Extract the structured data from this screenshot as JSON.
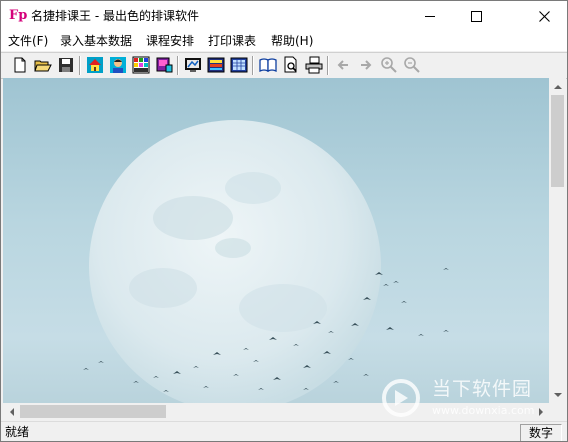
{
  "window": {
    "title": "名捷排课王 - 最出色的排课软件",
    "icon_letters": "Fp",
    "icon_name": "app-fp-icon"
  },
  "menu": [
    {
      "label": "文件(F)"
    },
    {
      "label": "录入基本数据"
    },
    {
      "label": "课程安排"
    },
    {
      "label": "打印课表"
    },
    {
      "label": "帮助(H)"
    }
  ],
  "toolbar": [
    {
      "icon": "new-file-icon"
    },
    {
      "icon": "open-folder-icon"
    },
    {
      "icon": "save-icon"
    },
    {
      "icon": "home-icon"
    },
    {
      "icon": "teacher-icon"
    },
    {
      "icon": "class-grid-icon"
    },
    {
      "icon": "course-book-icon"
    },
    {
      "icon": "monitor-schedule-icon"
    },
    {
      "icon": "color-table-icon"
    },
    {
      "icon": "table-view-icon"
    },
    {
      "icon": "open-book-icon"
    },
    {
      "icon": "print-preview-icon"
    },
    {
      "icon": "printer-icon"
    },
    {
      "icon": "arrow-left-icon"
    },
    {
      "icon": "arrow-right-icon"
    },
    {
      "icon": "zoom-in-icon"
    },
    {
      "icon": "zoom-out-icon"
    }
  ],
  "status": {
    "left": "就绪",
    "right": "数字"
  },
  "watermark": {
    "text": "当下软件园",
    "url": "www.downxia.com"
  },
  "colors": {
    "sky": "#b9d6e0",
    "moon": "#e6f0f3",
    "birds": "#38505a"
  }
}
